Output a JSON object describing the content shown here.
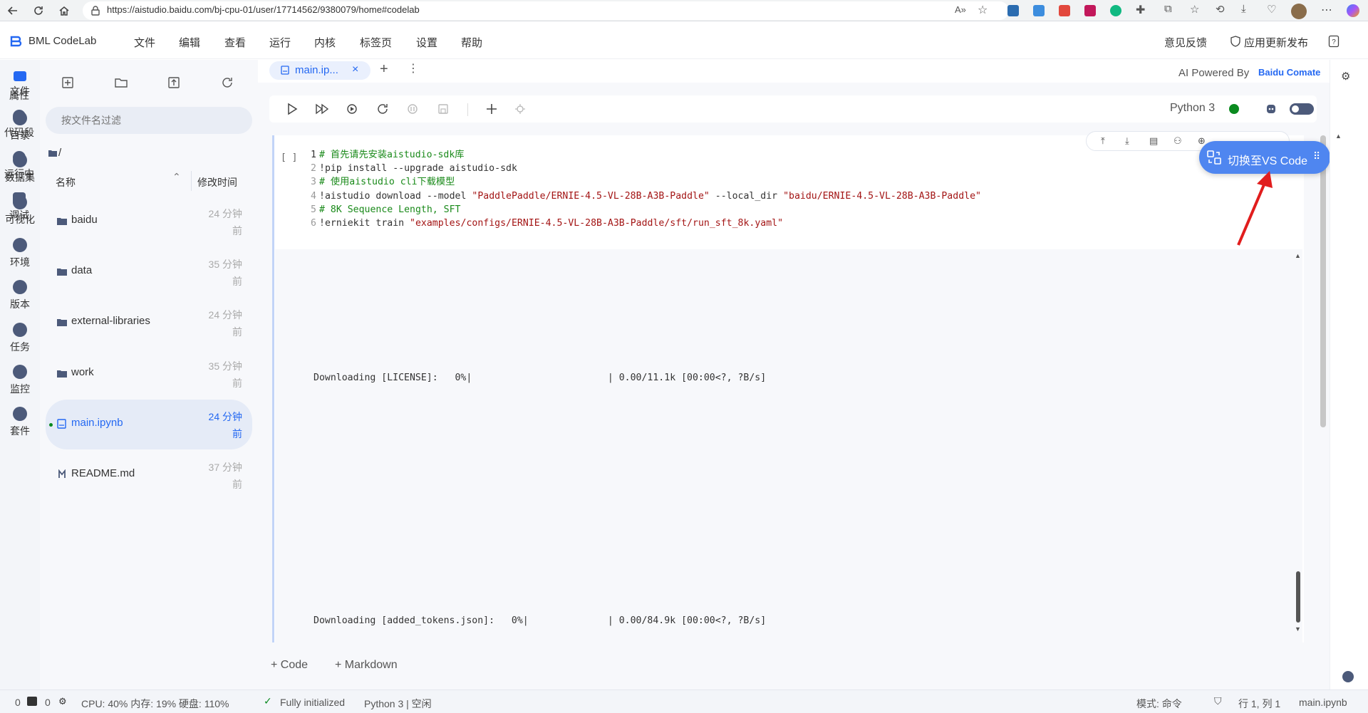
{
  "browser": {
    "url": "https://aistudio.baidu.com/bj-cpu-01/user/17714562/9380079/home#codelab",
    "back_icon": "arrow-left-icon",
    "refresh_icon": "refresh-icon",
    "home_icon": "home-icon"
  },
  "app": {
    "brand": "BML CodeLab",
    "menu": [
      "文件",
      "编辑",
      "查看",
      "运行",
      "内核",
      "标签页",
      "设置",
      "帮助"
    ],
    "feedback": "意见反馈",
    "release": "应用更新发布"
  },
  "rail": [
    {
      "label": "文件",
      "icon": "folder-icon"
    },
    {
      "label": "目录",
      "icon": "list-icon"
    },
    {
      "label": "数据集",
      "icon": "dataset-icon"
    },
    {
      "label": "可视化",
      "icon": "chart-icon"
    },
    {
      "label": "环境",
      "icon": "environment-icon"
    },
    {
      "label": "版本",
      "icon": "version-icon"
    },
    {
      "label": "任务",
      "icon": "task-icon"
    },
    {
      "label": "监控",
      "icon": "monitor-icon"
    },
    {
      "label": "套件",
      "icon": "kit-icon"
    }
  ],
  "file_panel": {
    "filter_placeholder": "按文件名过滤",
    "path": "/",
    "col_name": "名称",
    "col_time": "修改时间",
    "files": [
      {
        "name": "baidu",
        "time_1": "24 分钟",
        "time_2": "前",
        "icon": "folder-icon"
      },
      {
        "name": "data",
        "time_1": "35 分钟",
        "time_2": "前",
        "icon": "folder-icon"
      },
      {
        "name": "external-libraries",
        "time_1": "24 分钟",
        "time_2": "前",
        "icon": "folder-icon"
      },
      {
        "name": "work",
        "time_1": "35 分钟",
        "time_2": "前",
        "icon": "folder-icon"
      },
      {
        "name": "main.ipynb",
        "time_1": "24 分钟",
        "time_2": "前",
        "icon": "notebook-icon"
      },
      {
        "name": "README.md",
        "time_1": "37 分钟",
        "time_2": "前",
        "icon": "markdown-icon"
      }
    ]
  },
  "editor": {
    "tab_label": "main.ip...",
    "ai_powered": "AI Powered By",
    "ai_brand": "Baidu Comate",
    "kernel": "Python 3",
    "cell_prompt": "[ ]",
    "code_lines": [
      {
        "n": "1",
        "parts": [
          {
            "t": "# 首先请先安装aistudio-sdk库",
            "c": "cm"
          }
        ]
      },
      {
        "n": "2",
        "parts": [
          {
            "t": "!pip install --upgrade aistudio-sdk",
            "c": ""
          }
        ]
      },
      {
        "n": "3",
        "parts": [
          {
            "t": "# 使用aistudio cli下载模型",
            "c": "cm"
          }
        ]
      },
      {
        "n": "4",
        "parts": [
          {
            "t": "!aistudio download --model ",
            "c": ""
          },
          {
            "t": "\"PaddlePaddle/ERNIE-4.5-VL-28B-A3B-Paddle\"",
            "c": "str"
          },
          {
            "t": " --local_dir ",
            "c": ""
          },
          {
            "t": "\"baidu/ERNIE-4.5-VL-28B-A3B-Paddle\"",
            "c": "str"
          }
        ]
      },
      {
        "n": "5",
        "parts": [
          {
            "t": "# 8K Sequence Length, SFT",
            "c": "cm"
          }
        ]
      },
      {
        "n": "6",
        "parts": [
          {
            "t": "!erniekit train ",
            "c": ""
          },
          {
            "t": "\"examples/configs/ERNIE-4.5-VL-28B-A3B-Paddle/sft/run_sft_8k.yaml\"",
            "c": "str"
          }
        ]
      }
    ],
    "output_1": "Downloading [LICENSE]:   0%|                        | 0.00/11.1k [00:00<?, ?B/s]",
    "output_2": "Downloading [added_tokens.json]:   0%|              | 0.00/84.9k [00:00<?, ?B/s]",
    "add_code": "+ Code",
    "add_markdown": "+ Markdown",
    "vscode_button": "切换至VS Code"
  },
  "right_rail": [
    "属性",
    "代码段",
    "运行中",
    "调试"
  ],
  "status": {
    "left_count_1": "0",
    "left_count_2": "0",
    "resources": "CPU:  40% 内存:  19% 硬盘:  110%",
    "initialized": "Fully initialized",
    "kernel_state": "Python 3 | 空闲",
    "mode": "模式:  命令",
    "position": "行 1, 列 1",
    "file": "main.ipynb"
  },
  "colors": {
    "accent": "#2468f2",
    "vscode_button": "#4f86f0",
    "kernel_dot": "#0a8a1f"
  }
}
